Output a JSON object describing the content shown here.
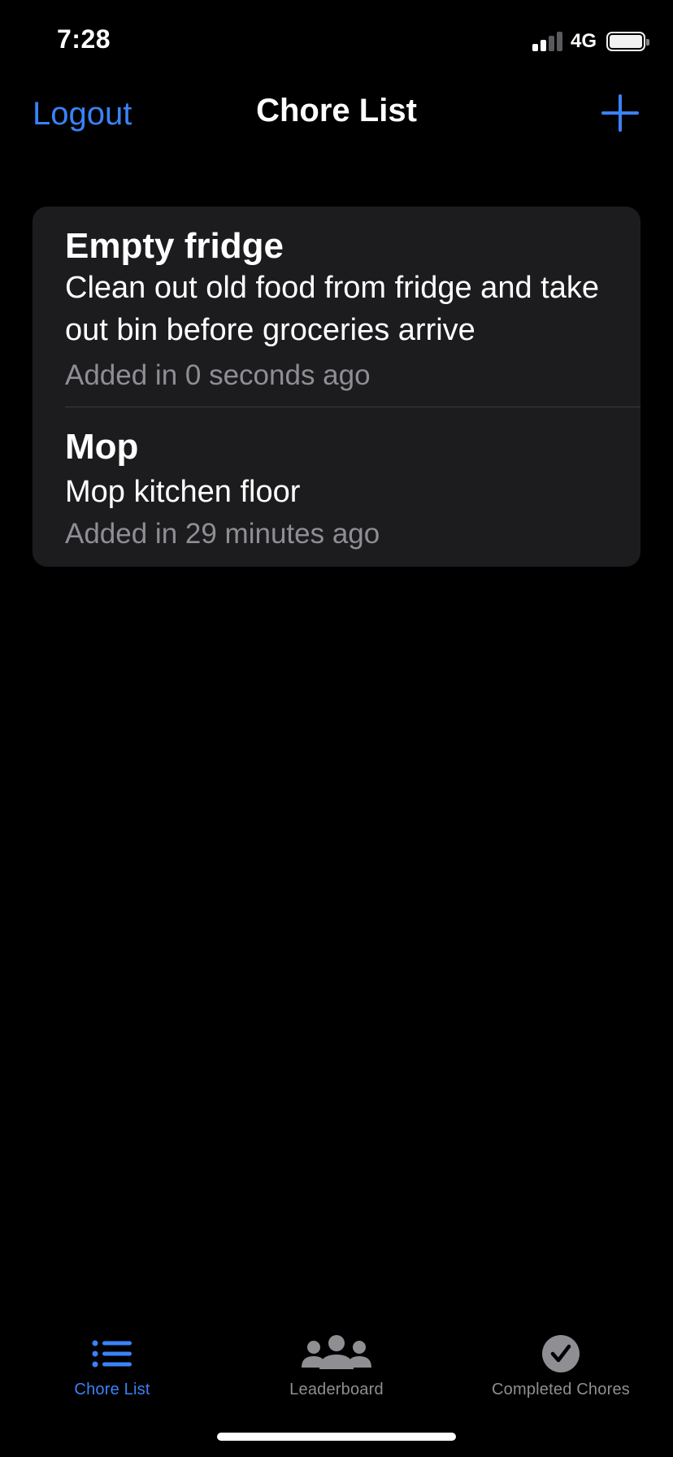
{
  "status_bar": {
    "time": "7:28",
    "network": "4G",
    "signal_bars_active": 2,
    "signal_bars_total": 4,
    "battery_level": 0.9
  },
  "nav": {
    "left_label": "Logout",
    "title": "Chore List",
    "add_icon": "plus-icon"
  },
  "chores": [
    {
      "title": "Empty fridge",
      "description": "Clean out old food from fridge and take out bin before groceries arrive",
      "added": "Added in 0 seconds ago"
    },
    {
      "title": "Mop",
      "description": "Mop kitchen floor",
      "added": "Added in 29 minutes ago"
    }
  ],
  "tabs": [
    {
      "label": "Chore List",
      "icon": "list-icon",
      "active": true
    },
    {
      "label": "Leaderboard",
      "icon": "people-icon",
      "active": false
    },
    {
      "label": "Completed Chores",
      "icon": "checkmark-circle-icon",
      "active": false
    }
  ],
  "colors": {
    "accent": "#3a82f7",
    "background": "#000000",
    "card": "#1c1c1e",
    "secondary_text": "#8e8e93"
  }
}
